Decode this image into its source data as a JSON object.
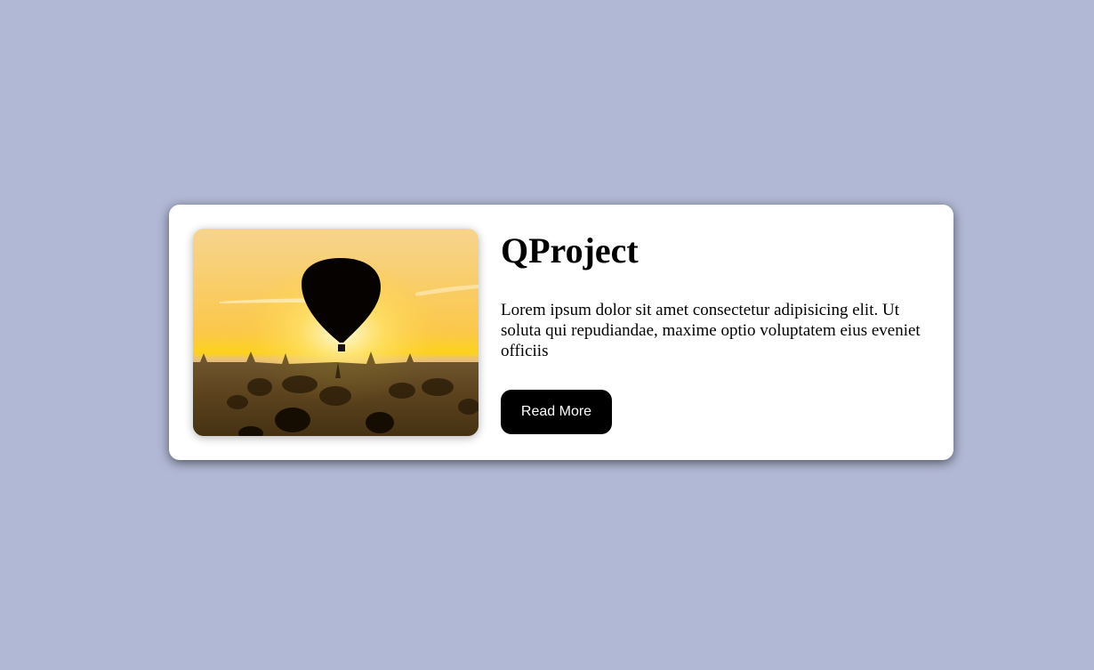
{
  "card": {
    "image_alt": "Hot air balloon at sunrise over temples",
    "title": "QProject",
    "description": "Lorem ipsum dolor sit amet consectetur adipisicing elit. Ut soluta qui repudiandae, maxime optio voluptatem eius eveniet officiis",
    "button_label": "Read More"
  },
  "colors": {
    "background": "#b1b8d5",
    "card": "#ffffff",
    "button": "#000000"
  }
}
